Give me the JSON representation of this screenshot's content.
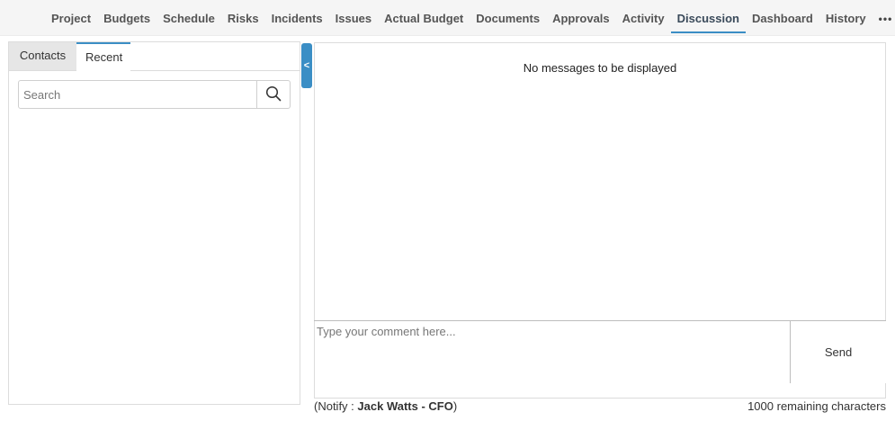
{
  "nav": {
    "items": [
      {
        "label": "Project"
      },
      {
        "label": "Budgets"
      },
      {
        "label": "Schedule"
      },
      {
        "label": "Risks"
      },
      {
        "label": "Incidents"
      },
      {
        "label": "Issues"
      },
      {
        "label": "Actual Budget"
      },
      {
        "label": "Documents"
      },
      {
        "label": "Approvals"
      },
      {
        "label": "Activity"
      },
      {
        "label": "Discussion"
      },
      {
        "label": "Dashboard"
      },
      {
        "label": "History"
      }
    ],
    "active": "Discussion",
    "more_label": "•••"
  },
  "sidebar": {
    "tabs": [
      {
        "label": "Contacts"
      },
      {
        "label": "Recent"
      }
    ],
    "active_tab": "Recent",
    "search": {
      "placeholder": "Search",
      "value": ""
    },
    "search_icon": "search-icon",
    "collapse_icon": "<"
  },
  "messages": {
    "empty_text": "No messages to be displayed"
  },
  "composer": {
    "placeholder": "Type your comment here...",
    "value": "",
    "send_label": "Send"
  },
  "footer": {
    "notify_prefix": "(Notify : ",
    "notify_name": "Jack Watts - CFO",
    "notify_suffix": ")",
    "remaining": "1000 remaining characters"
  },
  "colors": {
    "accent": "#3b8ec5"
  }
}
